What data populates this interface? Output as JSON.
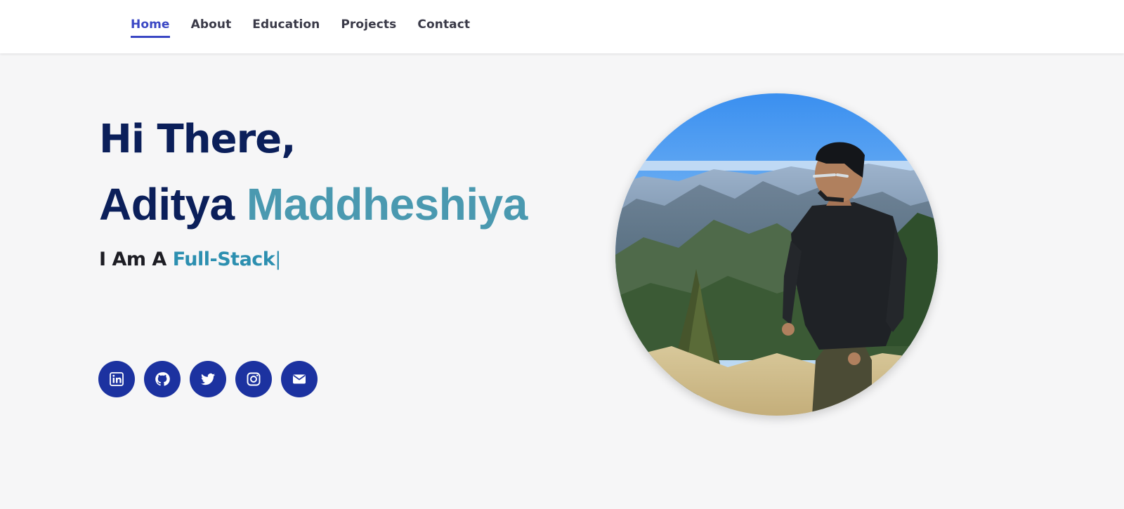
{
  "nav": {
    "items": [
      {
        "label": "Home",
        "active": true
      },
      {
        "label": "About",
        "active": false
      },
      {
        "label": "Education",
        "active": false
      },
      {
        "label": "Projects",
        "active": false
      },
      {
        "label": "Contact",
        "active": false
      }
    ],
    "active_color": "#3a47c4"
  },
  "hero": {
    "greeting": "Hi There,",
    "first_name": "Aditya",
    "last_name": "Maddheshiya",
    "tagline_prefix": "I Am A",
    "role": "Full-Stack",
    "cursor": "|"
  },
  "socials": [
    {
      "icon": "linkedin-icon"
    },
    {
      "icon": "github-icon"
    },
    {
      "icon": "twitter-icon"
    },
    {
      "icon": "instagram-icon"
    },
    {
      "icon": "email-icon"
    }
  ],
  "colors": {
    "heading": "#0b1f5a",
    "accent": "#4a99b0",
    "social_bg": "#1c32a0",
    "background": "#f6f6f7"
  },
  "profile_photo": {
    "icon": "profile-photo"
  }
}
